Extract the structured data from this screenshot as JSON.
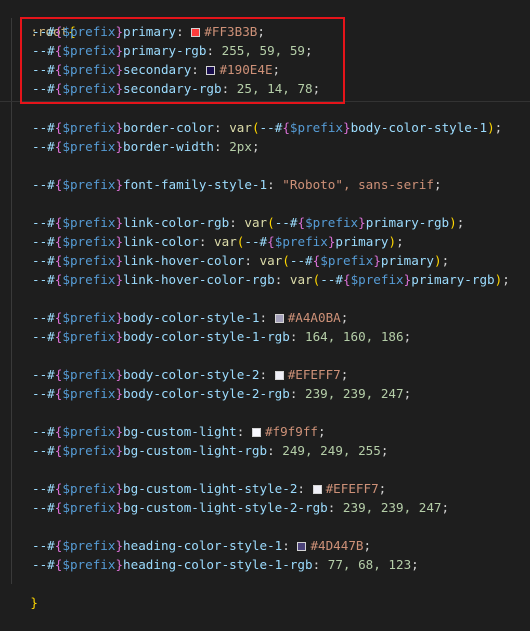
{
  "root_selector": ":root",
  "open_brace": "{",
  "close_brace": "}",
  "var_name": "$prefix",
  "lines": [
    {
      "prop": "primary",
      "swatch": "#FF3B3B",
      "value": "#FF3B3B"
    },
    {
      "prop": "primary-rgb",
      "value": "255, 59, 59"
    },
    {
      "prop": "secondary",
      "swatch": "#190E4E",
      "value": "#190E4E"
    },
    {
      "prop": "secondary-rgb",
      "value": "25, 14, 78"
    },
    {
      "prop": "border-color",
      "func": "var",
      "ref": "body-color-style-1"
    },
    {
      "prop": "border-width",
      "value": "2px"
    },
    {
      "prop": "font-family-style-1",
      "string": "\"Roboto\"",
      "rest": ", sans-serif"
    },
    {
      "prop": "link-color-rgb",
      "func": "var",
      "ref": "primary-rgb"
    },
    {
      "prop": "link-color",
      "func": "var",
      "ref": "primary"
    },
    {
      "prop": "link-hover-color",
      "func": "var",
      "ref": "primary"
    },
    {
      "prop": "link-hover-color-rgb",
      "func": "var",
      "ref": "primary-rgb"
    },
    {
      "prop": "body-color-style-1",
      "swatch": "#A4A0BA",
      "value": "#A4A0BA"
    },
    {
      "prop": "body-color-style-1-rgb",
      "value": "164, 160, 186"
    },
    {
      "prop": "body-color-style-2",
      "swatch": "#EFEFF7",
      "value": "#EFEFF7"
    },
    {
      "prop": "body-color-style-2-rgb",
      "value": "239, 239, 247"
    },
    {
      "prop": "bg-custom-light",
      "swatch": "#f9f9ff",
      "value": "#f9f9ff"
    },
    {
      "prop": "bg-custom-light-rgb",
      "value": "249, 249, 255"
    },
    {
      "prop": "bg-custom-light-style-2",
      "swatch": "#EFEFF7",
      "value": "#EFEFF7"
    },
    {
      "prop": "bg-custom-light-style-2-rgb",
      "value": "239, 239, 247"
    },
    {
      "prop": "heading-color-style-1",
      "swatch": "#4D447B",
      "value": "#4D447B"
    },
    {
      "prop": "heading-color-style-1-rgb",
      "value": "77, 68, 123"
    }
  ]
}
